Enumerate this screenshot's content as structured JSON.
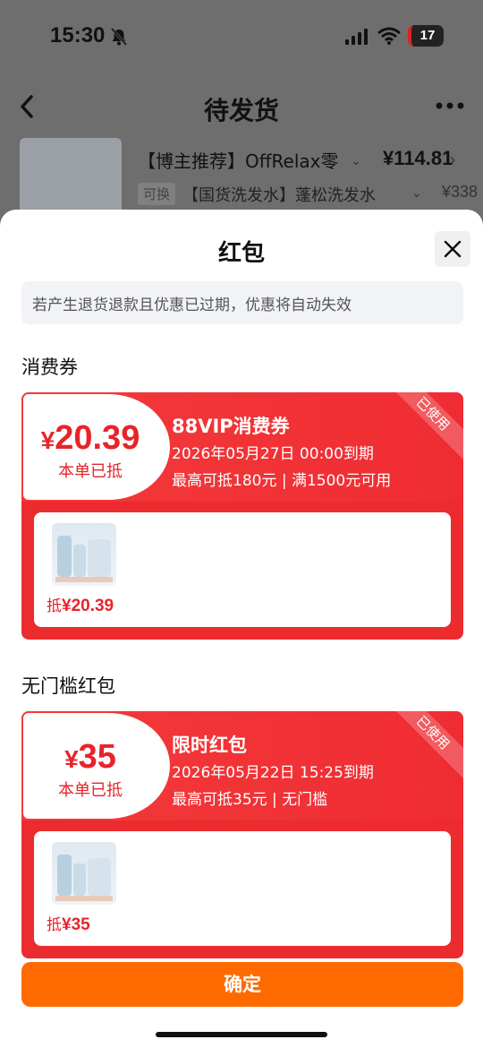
{
  "status_bar": {
    "time": "15:30",
    "battery": "17"
  },
  "nav": {
    "title": "待发货"
  },
  "background_product": {
    "name": "【博主推荐】OffRelax零",
    "price": "¥114.81",
    "tag": "可换",
    "sub_name": "【国货洗发水】蓬松洗发水",
    "sub_price": "¥338"
  },
  "sheet": {
    "title": "红包",
    "notice": "若产生退货退款且优惠已过期，优惠将自动失效",
    "confirm_label": "确定"
  },
  "sections": [
    {
      "title": "消费券",
      "coupon": {
        "currency": "¥",
        "amount": "20.39",
        "status": "本单已抵",
        "name": "88VIP消费券",
        "expire": "2026年05月27日 00:00到期",
        "rule": "最高可抵180元 | 满1500元可用",
        "stamp": "已使用",
        "deduct_prefix": "抵",
        "deduct_value": "¥20.39"
      }
    },
    {
      "title": "无门槛红包",
      "coupon": {
        "currency": "¥",
        "amount": "35",
        "status": "本单已抵",
        "name": "限时红包",
        "expire": "2026年05月22日 15:25到期",
        "rule": "最高可抵35元 | 无门槛",
        "stamp": "已使用",
        "deduct_prefix": "抵",
        "deduct_value": "¥35"
      }
    }
  ],
  "colors": {
    "accent_red": "#ec2b2e",
    "confirm_orange": "#ff6a00"
  },
  "icons": [
    "silent-bell-icon",
    "signal-icon",
    "wifi-icon",
    "back-arrow-icon",
    "more-icon",
    "close-icon"
  ]
}
